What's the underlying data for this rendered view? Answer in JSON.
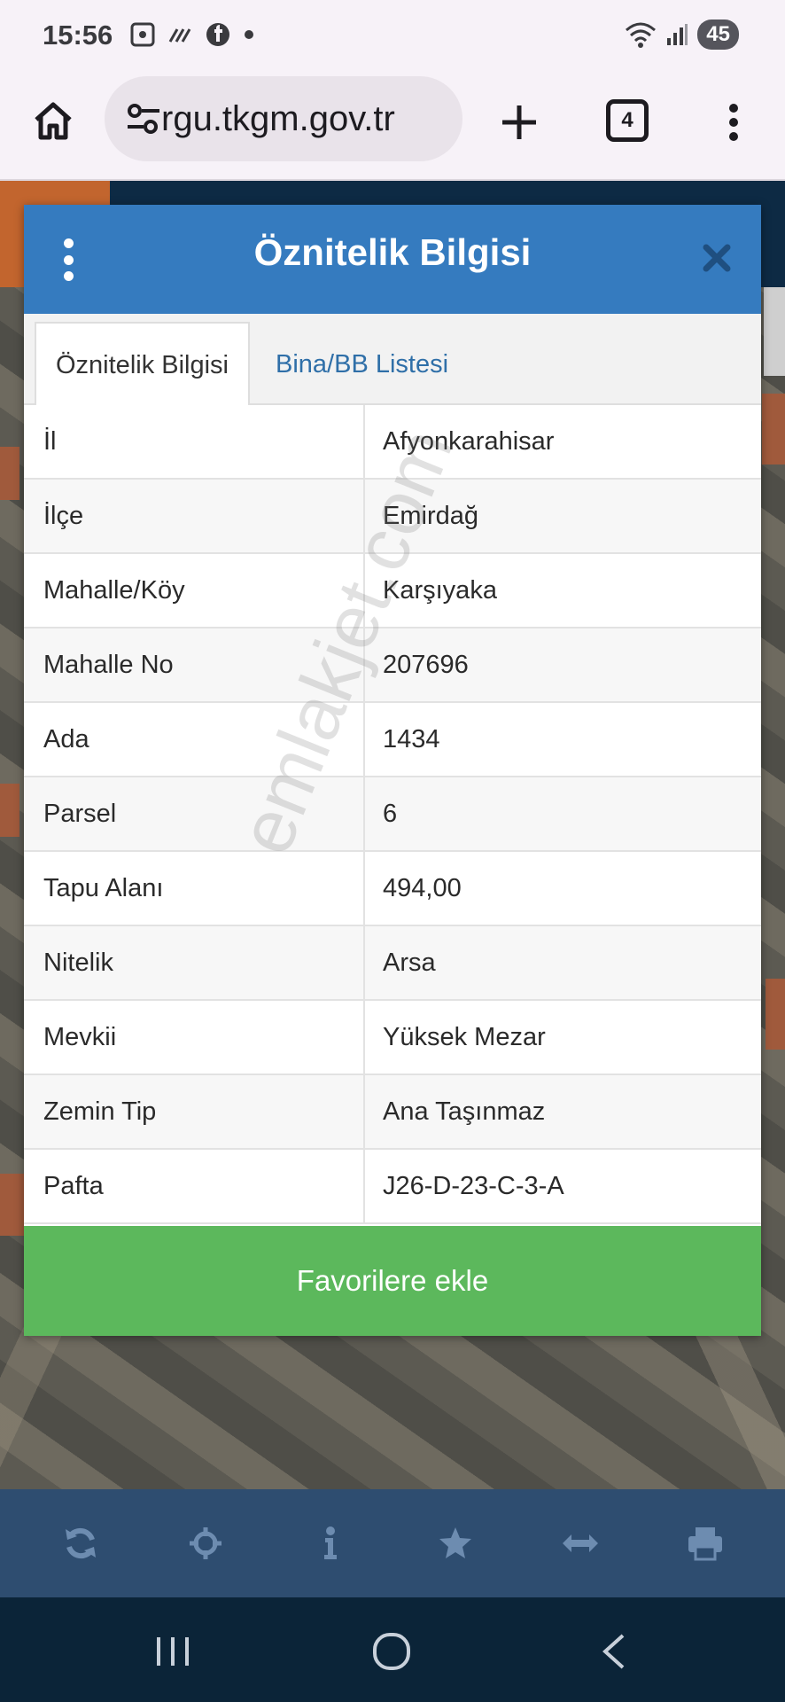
{
  "status_bar": {
    "time": "15:56",
    "battery": "45",
    "icons": [
      "screenshot-icon",
      "signal-wave-icon",
      "facebook-icon",
      "dot-icon",
      "wifi-icon",
      "cell-signal-icon"
    ]
  },
  "browser": {
    "url_text": "rgu.tkgm.gov.tr",
    "tab_count": "4"
  },
  "dialog": {
    "title": "Öznitelik Bilgisi",
    "tabs": [
      {
        "label": "Öznitelik Bilgisi",
        "active": true
      },
      {
        "label": "Bina/BB Listesi",
        "active": false
      }
    ],
    "rows": [
      {
        "label": "İl",
        "value": "Afyonkarahisar"
      },
      {
        "label": "İlçe",
        "value": "Emirdağ"
      },
      {
        "label": "Mahalle/Köy",
        "value": "Karşıyaka"
      },
      {
        "label": "Mahalle No",
        "value": "207696"
      },
      {
        "label": "Ada",
        "value": "1434"
      },
      {
        "label": "Parsel",
        "value": "6"
      },
      {
        "label": "Tapu Alanı",
        "value": "494,00"
      },
      {
        "label": "Nitelik",
        "value": "Arsa"
      },
      {
        "label": "Mevkii",
        "value": "Yüksek Mezar"
      },
      {
        "label": "Zemin Tip",
        "value": "Ana Taşınmaz"
      },
      {
        "label": "Pafta",
        "value": "J26-D-23-C-3-A"
      }
    ],
    "favorite_button": "Favorilere ekle"
  },
  "watermark": "emlakjet.com",
  "toolbar": {
    "icons": [
      "refresh-icon",
      "crosshair-icon",
      "info-icon",
      "star-icon",
      "measure-arrows-icon",
      "print-icon"
    ]
  },
  "colors": {
    "header_blue": "#357bbf",
    "favorite_green": "#5cb85c",
    "toolbar_navy": "#2e4d70",
    "tab_link_blue": "#2f6fa8"
  }
}
